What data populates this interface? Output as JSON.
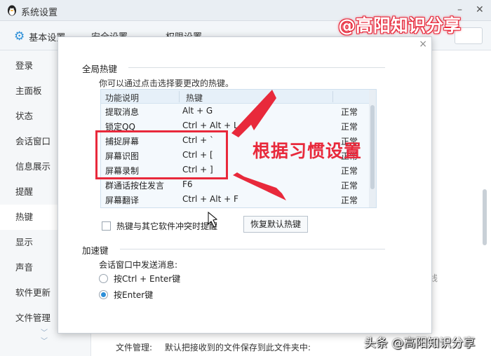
{
  "window": {
    "title": "系统设置",
    "minimize_glyph": "–",
    "close_glyph": "✕"
  },
  "topnav": {
    "tabs": [
      "基本设置",
      "安全设置",
      "权限设置"
    ]
  },
  "sidebar": {
    "items": [
      "登录",
      "主面板",
      "状态",
      "会话窗口",
      "信息展示",
      "提醒",
      "热键",
      "显示",
      "声音",
      "软件更新",
      "文件管理"
    ],
    "active_index": 6
  },
  "background": {
    "footer_label": "文件管理:",
    "footer_text": "默认把接收到的文件保存到此文件夹中:",
    "partial_text": "线"
  },
  "dialog": {
    "close_glyph": "×",
    "global_section_title": "全局热键",
    "hint": "你可以通过点击选择要更改的热键。",
    "table": {
      "headers": [
        "功能说明",
        "热键"
      ],
      "rows": [
        {
          "name": "提取消息",
          "key": "Alt + G",
          "status": "正常"
        },
        {
          "name": "锁定QQ",
          "key": "Ctrl + Alt + L",
          "status": "正常"
        },
        {
          "name": "捕捉屏幕",
          "key": "Ctrl + `",
          "status": "正常"
        },
        {
          "name": "屏幕识图",
          "key": "Ctrl + [",
          "status": "正常"
        },
        {
          "name": "屏幕录制",
          "key": "Ctrl + ]",
          "status": "正常"
        },
        {
          "name": "群通话按住发言",
          "key": "F6",
          "status": "正常"
        },
        {
          "name": "屏幕翻译",
          "key": "Ctrl + Alt + F",
          "status": "正常"
        }
      ]
    },
    "conflict_checkbox_label": "热键与其它软件冲突时提醒",
    "conflict_checked": false,
    "restore_button": "恢复默认热键",
    "accel_section_title": "加速键",
    "send_label": "会话窗口中发送消息:",
    "radio_options": [
      "按Ctrl + Enter键",
      "按Enter键"
    ],
    "radio_selected_index": 1
  },
  "overlay": {
    "annotation": "根据习惯设置",
    "watermark_top": "@高阳知识分享",
    "watermark_bottom": "头条 @高阳知识分享",
    "accent_color": "#e8293b"
  }
}
